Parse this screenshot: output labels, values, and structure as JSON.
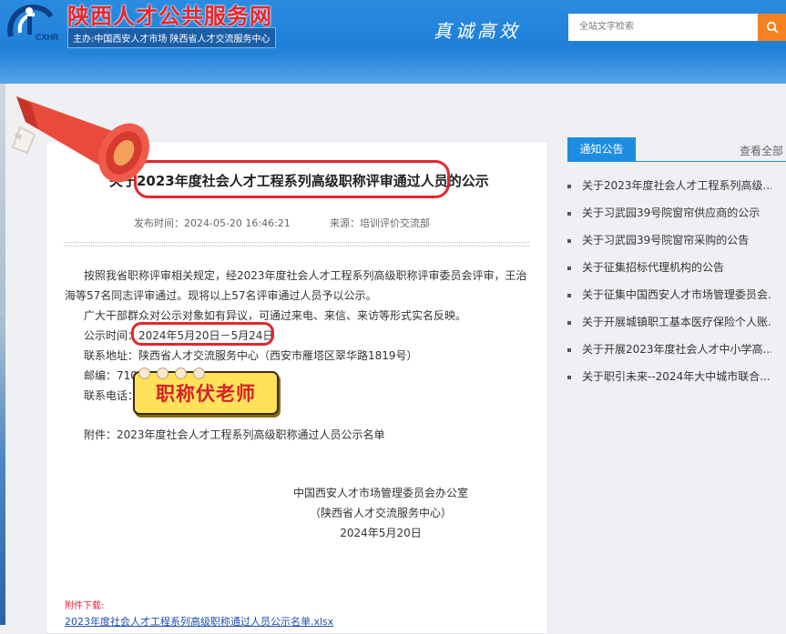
{
  "header": {
    "site_title": "陕西人才公共服务网",
    "logo_text": "CXHR",
    "subtitle": "主办:中国西安人才市场  陕西省人才交流服务中心",
    "slogan": "真诚高效",
    "search_placeholder": "全站文字检索",
    "colors": {
      "header_blue": "#2a8ce0",
      "title_red": "#e8262b",
      "search_orange": "#f58220"
    }
  },
  "article": {
    "title": "关于2023年度社会人才工程系列高级职称评审通过人员的公示",
    "publish_time": "发布时间：2024-05-20 16:46:21",
    "source": "来源：培训评价交流部",
    "para1_line1": "按照我省职称评审相关规定，经2023年度社会人才工程系列高级职称评审委员会评审，王治",
    "para1_line2": "海等57名同志评审通过。现将以上57名评审通过人员予以公示。",
    "para2": "广大干部群众对公示对象如有异议，可通过来电、来信、来访等形式实名反映。",
    "notice_period_label": "公示时间：",
    "notice_period_value": "2024年5月20日－5月24日",
    "address": "联系地址：陕西省人才交流服务中心（西安市雁塔区翠华路1819号）",
    "postcode": "邮编：7100",
    "phone": "联系电话：",
    "attachment_note": "附件：2023年度社会人才工程系列高级职称通过人员公示名单",
    "signature_line1": "中国西安人才市场管理委员会办公室",
    "signature_line2": "（陕西省人才交流服务中心）",
    "signature_date": "2024年5月20日",
    "download_label": "附件下载:",
    "download_link": "2023年度社会人才工程系列高级职称通过人员公示名单.xlsx"
  },
  "overlay": {
    "badge_text": "职称伏老师",
    "megaphone_icon": "megaphone-icon",
    "highlight_color": "#e3262f"
  },
  "sidebar": {
    "tab_label": "通知公告",
    "see_all": "查看全部",
    "items": [
      "关于2023年度社会人才工程系列高级...",
      "关于习武园39号院窗帘供应商的公示",
      "关于习武园39号院窗帘采购的公告",
      "关于征集招标代理机构的公告",
      "关于征集中国西安人才市场管理委员会...",
      "关于开展城镇职工基本医疗保险个人账...",
      "关于开展2023年度社会人才中小学高...",
      "关于职引未来--2024年大中城市联合..."
    ]
  }
}
